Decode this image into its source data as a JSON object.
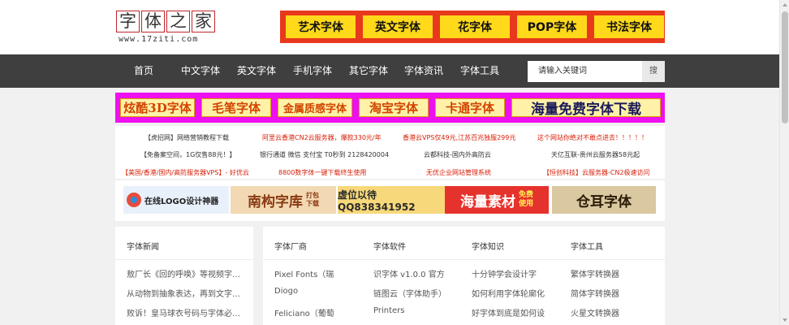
{
  "logo": {
    "chars": [
      "字",
      "体",
      "之",
      "家"
    ],
    "url": "www.17ziti.com"
  },
  "top_tags": [
    "艺术字体",
    "英文字体",
    "花字体",
    "POP字体",
    "书法字体"
  ],
  "nav": {
    "items": [
      "首页",
      "中文字体",
      "英文字体",
      "手机字体",
      "其它字体",
      "字体资讯",
      "字体工具"
    ],
    "search_placeholder": "请输入关键词",
    "search_button": "搜"
  },
  "banner": [
    "炫酷3D字体",
    "毛笔字体",
    "金属质感字体",
    "淘宝字体",
    "卡通字体",
    "海量免费字体下载"
  ],
  "ads": {
    "row1": [
      "【虎招网】网络营销教程下载",
      "阿里云香港CN2云服务器，爆款330元/年",
      "香港云VPS仅49元,江苏百兆独服299元",
      "这个网站你绝对不敢点进去！！！！！"
    ],
    "row2": [
      "【免备案空间，1G仅售88元！】",
      "银行通道 微信 支付宝 T0秒到 2128420004",
      "云都科技-国内外高防云",
      "天亿互联-贵州云服务器58元起"
    ],
    "row3": [
      "【美国/香港/国内/高防服务器VPS】- 好优云",
      "8800数字体一键下载终生使用",
      "无优企业网站管理系统",
      "【恒创科技】云服务器-CN2极速访问"
    ]
  },
  "image_ads": {
    "logo_maker": "在线LOGO设计神器",
    "nangou": "南构字库",
    "nangou_sub": [
      "打包",
      "下载"
    ],
    "qq": "虚位以待 QQ838341952",
    "haisu": "海量素材",
    "haisu_sub": [
      "免费",
      "使用"
    ],
    "cangxie": "仓耳字体"
  },
  "news": {
    "title": "字体新闻",
    "items": [
      "敖厂长《回的呼唤》等视频字…",
      "从动物到抽象表达，再到文字…",
      "败诉！皇马球衣号码与字体必…"
    ]
  },
  "columns": [
    {
      "title": "字体厂商",
      "items": [
        "Pixel Fonts（瑞",
        "Diogo",
        "Feliciano（葡萄"
      ]
    },
    {
      "title": "字体软件",
      "items": [
        "识字体 v1.0.0 官方",
        "链图云（字体助手）",
        "Printers"
      ]
    },
    {
      "title": "字体知识",
      "items": [
        "十分钟学会设计字",
        "如何利用字体轮廓化",
        "好字体到底是如何设"
      ]
    },
    {
      "title": "字体工具",
      "items": [
        "繁体字转换器",
        "简体字转换器",
        "火星文转换器"
      ]
    }
  ]
}
